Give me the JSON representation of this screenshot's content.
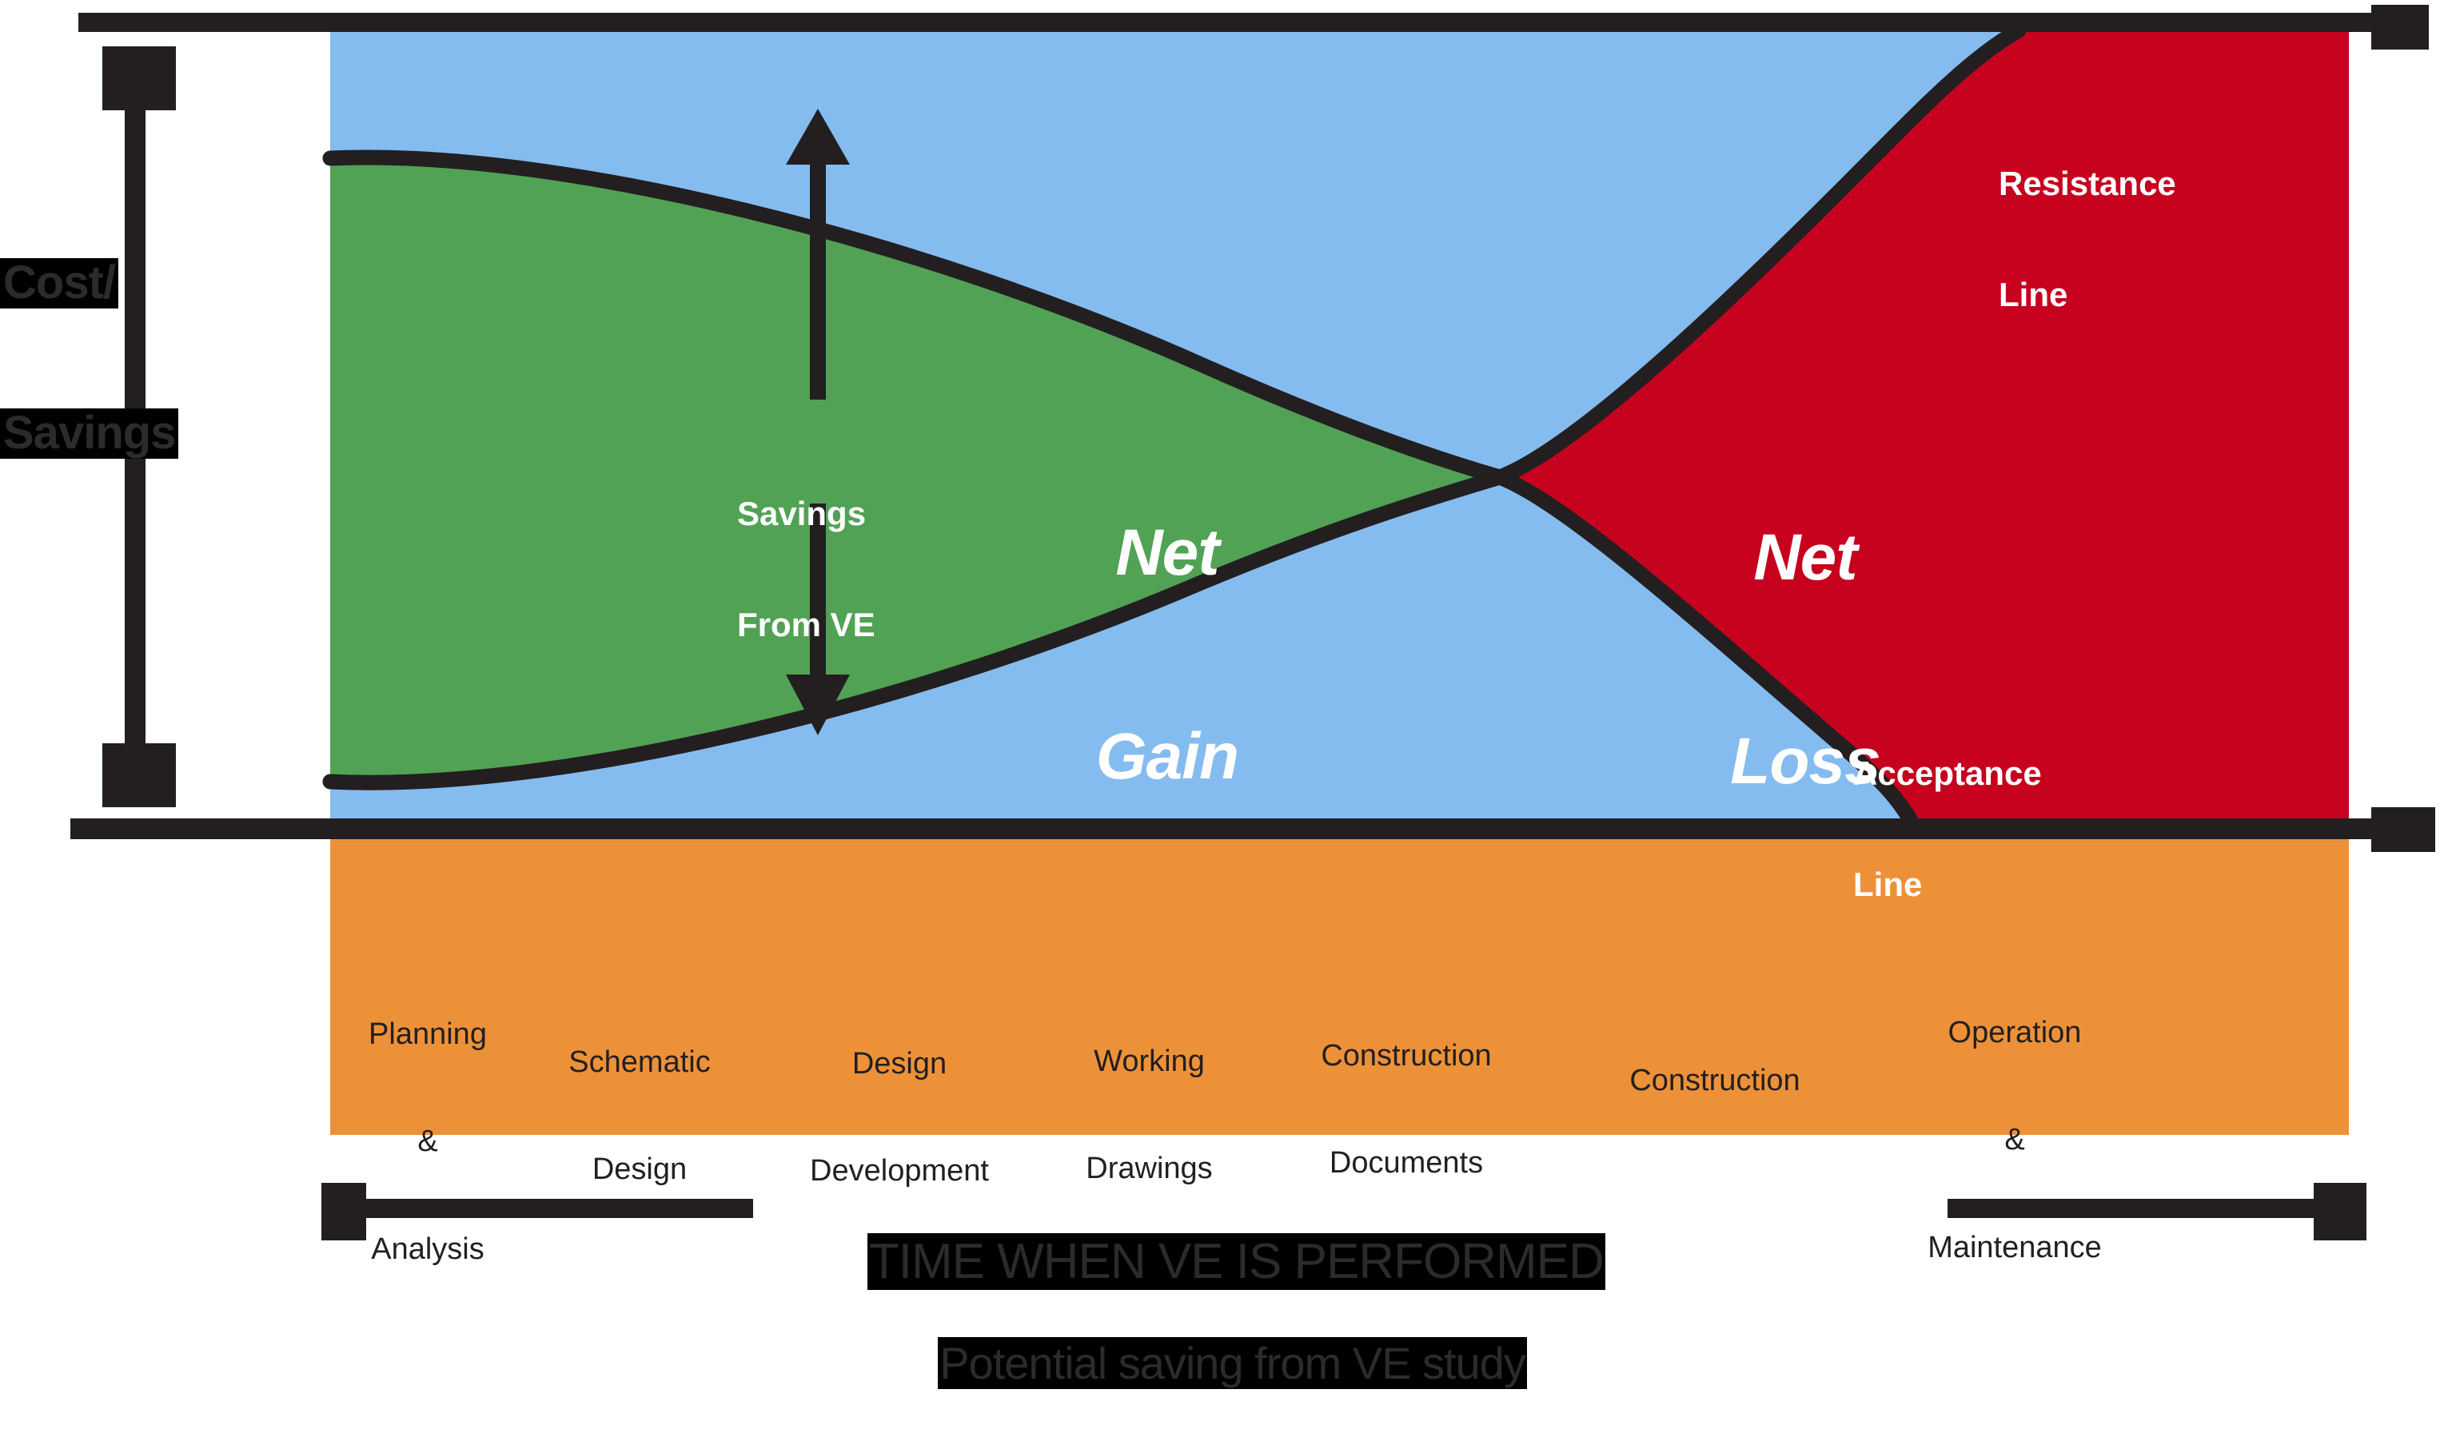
{
  "chart_data": {
    "type": "area",
    "title": "Potential saving from VE study",
    "xlabel": "TIME WHEN VE IS PERFORMED",
    "ylabel": "Cost/ Savings",
    "grid": false,
    "legend": null,
    "categories": [
      "Planning & Analysis",
      "Schematic Design",
      "Design Development",
      "Working Drawings",
      "Construction Documents",
      "Construction",
      "Operation & Maintenance"
    ],
    "series": [
      {
        "name": "Resistance Line",
        "description": "Upper boundary: starts high-left, descends to crossover, then rises steeply to top-right",
        "points": [
          {
            "x": 0.0,
            "y": 0.9
          },
          {
            "x": 0.15,
            "y": 0.88
          },
          {
            "x": 0.35,
            "y": 0.74
          },
          {
            "x": 0.5,
            "y": 0.6
          },
          {
            "x": 0.58,
            "y": 0.5
          },
          {
            "x": 0.7,
            "y": 0.68
          },
          {
            "x": 0.8,
            "y": 0.85
          },
          {
            "x": 0.86,
            "y": 1.0
          }
        ]
      },
      {
        "name": "Acceptance Line",
        "description": "Lower boundary: starts low-left, rises to crossover, then falls steeply to baseline at right",
        "points": [
          {
            "x": 0.0,
            "y": 0.1
          },
          {
            "x": 0.15,
            "y": 0.12
          },
          {
            "x": 0.35,
            "y": 0.26
          },
          {
            "x": 0.5,
            "y": 0.4
          },
          {
            "x": 0.58,
            "y": 0.5
          },
          {
            "x": 0.7,
            "y": 0.32
          },
          {
            "x": 0.8,
            "y": 0.14
          },
          {
            "x": 0.84,
            "y": 0.0
          }
        ]
      }
    ],
    "regions": [
      {
        "name": "Net Gain",
        "color": "#51a254",
        "span": "left of crossover"
      },
      {
        "name": "Net Loss",
        "color": "#c6021f",
        "span": "right of crossover"
      },
      {
        "name": "background",
        "color": "#85bcf0"
      }
    ],
    "annotations": [
      {
        "label": "Savings From VE",
        "type": "double-headed-arrow",
        "orientation": "vertical"
      },
      {
        "label": "Net Gain",
        "type": "region-label"
      },
      {
        "label": "Net Loss",
        "type": "region-label"
      },
      {
        "label": "Resistance Line",
        "type": "line-label"
      },
      {
        "label": "Acceptance Line",
        "type": "line-label"
      }
    ],
    "colors": {
      "background_band": "#85bcf0",
      "gain": "#51a254",
      "loss": "#c6021f",
      "phase_bar": "#ed9139",
      "ink": "#231f20",
      "label_text": "#ffffff"
    }
  },
  "axes": {
    "y_title_line1": "Cost/",
    "y_title_line2": "Savings",
    "x_title": "TIME WHEN VE IS PERFORMED"
  },
  "caption": "Potential saving from VE study",
  "regions": {
    "gain_line1": "Net",
    "gain_line2": "Gain",
    "loss_line1": "Net",
    "loss_line2": "Loss"
  },
  "annotations": {
    "savings_line1": "Savings",
    "savings_line2": "From VE",
    "resistance_line1": "Resistance",
    "resistance_line2": "Line",
    "acceptance_line1": "Acceptance",
    "acceptance_line2": "Line"
  },
  "phases": [
    {
      "line1": "Planning",
      "line2": "&",
      "line3": "Analysis"
    },
    {
      "line1": "Schematic",
      "line2": "Design",
      "line3": ""
    },
    {
      "line1": "Design",
      "line2": "Development",
      "line3": ""
    },
    {
      "line1": "Working",
      "line2": "Drawings",
      "line3": ""
    },
    {
      "line1": "Construction",
      "line2": "Documents",
      "line3": ""
    },
    {
      "line1": "Construction",
      "line2": "",
      "line3": ""
    },
    {
      "line1": "Operation",
      "line2": "&",
      "line3": "Maintenance"
    }
  ]
}
